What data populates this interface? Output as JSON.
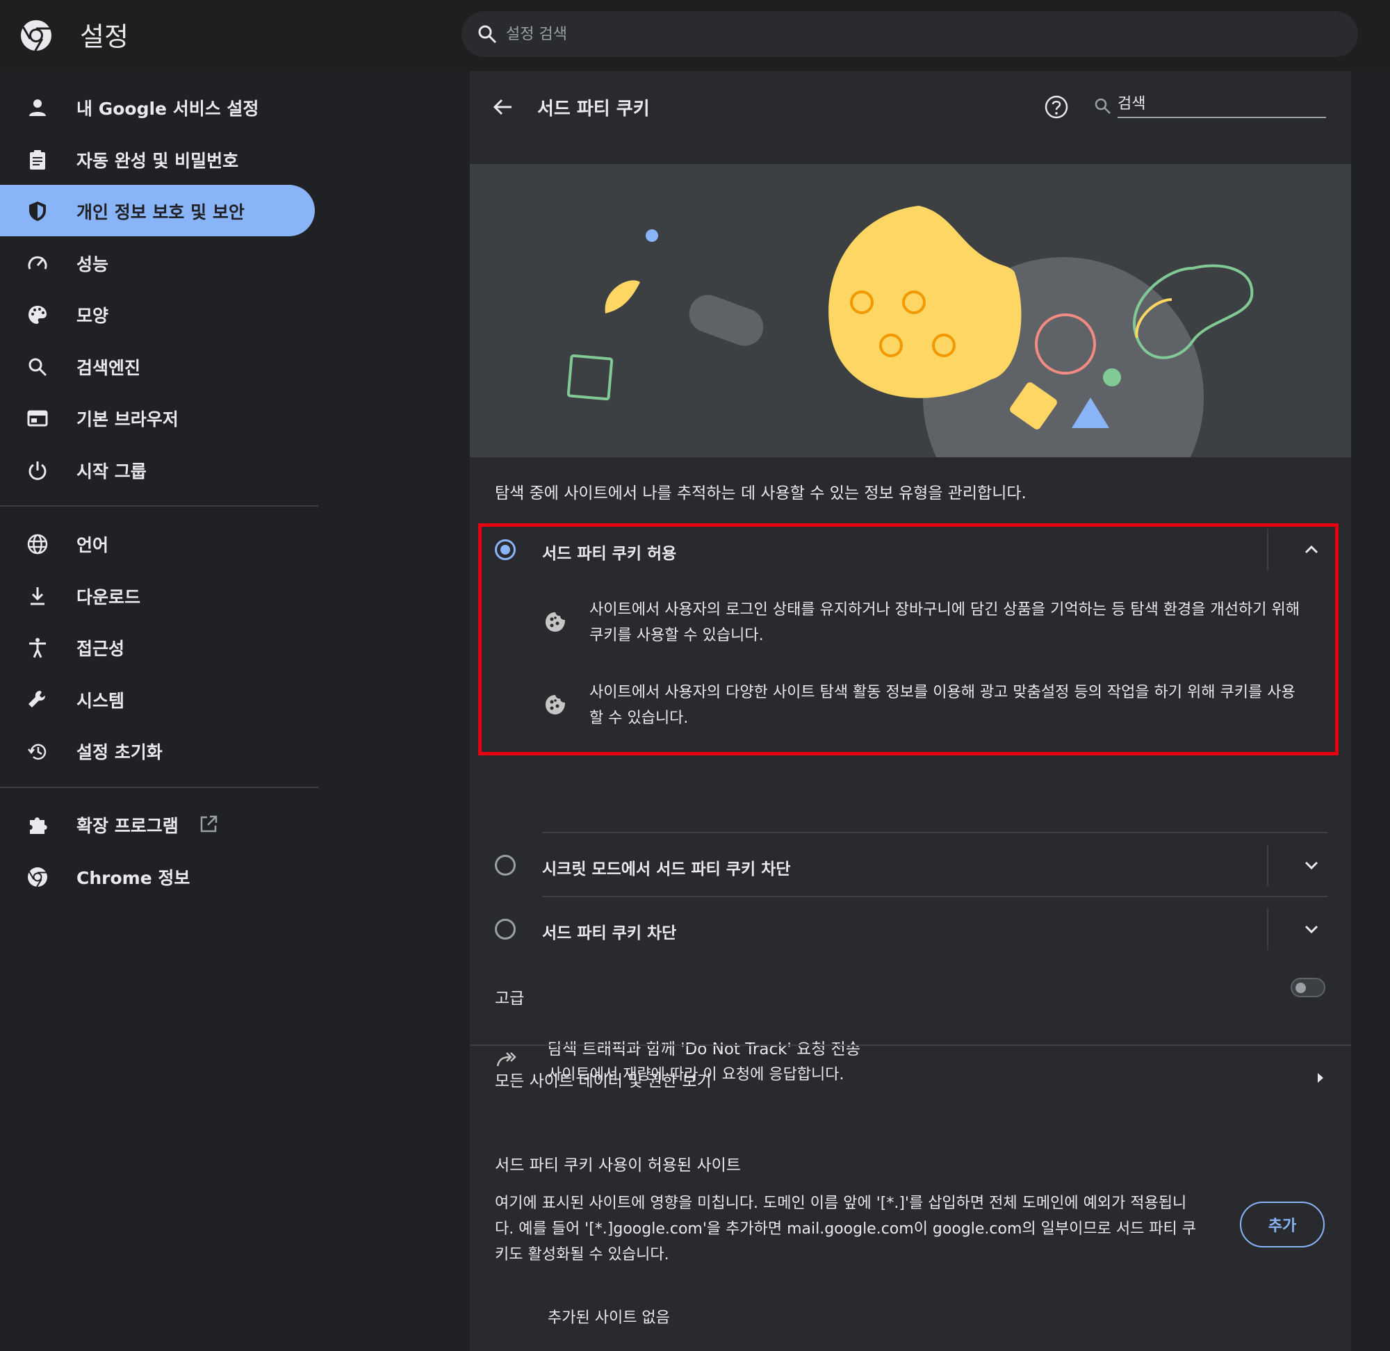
{
  "header": {
    "title": "설정",
    "search_placeholder": "설정 검색"
  },
  "sidebar": {
    "items": [
      {
        "label": "내 Google 서비스 설정",
        "icon": "person-icon"
      },
      {
        "label": "자동 완성 및 비밀번호",
        "icon": "clipboard-icon"
      },
      {
        "label": "개인 정보 보호 및 보안",
        "icon": "shield-icon",
        "active": true
      },
      {
        "label": "성능",
        "icon": "speedometer-icon"
      },
      {
        "label": "모양",
        "icon": "palette-icon"
      },
      {
        "label": "검색엔진",
        "icon": "search-icon"
      },
      {
        "label": "기본 브라우저",
        "icon": "browser-icon"
      },
      {
        "label": "시작 그룹",
        "icon": "power-icon"
      },
      {
        "label": "언어",
        "icon": "globe-icon"
      },
      {
        "label": "다운로드",
        "icon": "download-icon"
      },
      {
        "label": "접근성",
        "icon": "accessibility-icon"
      },
      {
        "label": "시스템",
        "icon": "wrench-icon"
      },
      {
        "label": "설정 초기화",
        "icon": "restore-icon"
      },
      {
        "label": "확장 프로그램",
        "icon": "puzzle-icon"
      },
      {
        "label": "Chrome 정보",
        "icon": "chrome-icon"
      }
    ]
  },
  "page": {
    "title": "서드 파티 쿠키",
    "search_placeholder": "검색",
    "description": "탐색 중에 사이트에서 나를 추적하는 데 사용할 수 있는 정보 유형을 관리합니다.",
    "options": [
      {
        "label": "서드 파티 쿠키 허용",
        "selected": true,
        "expanded": true,
        "bullets": [
          [
            "사이트에서 사용자의 로그인 상태를 유지하거나 장바구니에 담긴 상품을 기억하는 등 탐색 환경을 개선하기 위해",
            "쿠키를 사용할 수 있습니다."
          ],
          [
            "사이트에서 사용자의 다양한 사이트 탐색 활동 정보를 이용해 광고 맞춤설정 등의 작업을 하기 위해 쿠키를 사용",
            "할 수 있습니다."
          ]
        ]
      },
      {
        "label": "시크릿 모드에서 서드 파티 쿠키 차단",
        "selected": false
      },
      {
        "label": "서드 파티 쿠키 차단",
        "selected": false
      }
    ],
    "advanced": {
      "heading": "고급",
      "dnt_title": "탐색 트래픽과 함께 'Do Not Track' 요청 전송",
      "dnt_subtitle": "사이트에서 재량에 따라 이 요청에 응답합니다.",
      "dnt_enabled": false
    },
    "site_data_link": "모든 사이트 데이터 및 권한 보기",
    "allowed_sites": {
      "heading": "서드 파티 쿠키 사용이 허용된 사이트",
      "lines": [
        "여기에 표시된 사이트에 영향을 미칩니다. 도메인 이름 앞에 '[*.]'를 삽입하면 전체 도메인에 예외가 적용됩니",
        "다. 예를 들어 '[*.]google.com'을 추가하면 mail.google.com이 google.com의 일부이므로 서드 파티 쿠",
        "키도 활성화될 수 있습니다."
      ],
      "add_label": "추가",
      "empty_text": "추가된 사이트 없음"
    }
  },
  "colors": {
    "accent": "#8ab4f8",
    "highlight_border": "#e3000f",
    "background": "#202124",
    "card": "#292a2d"
  }
}
